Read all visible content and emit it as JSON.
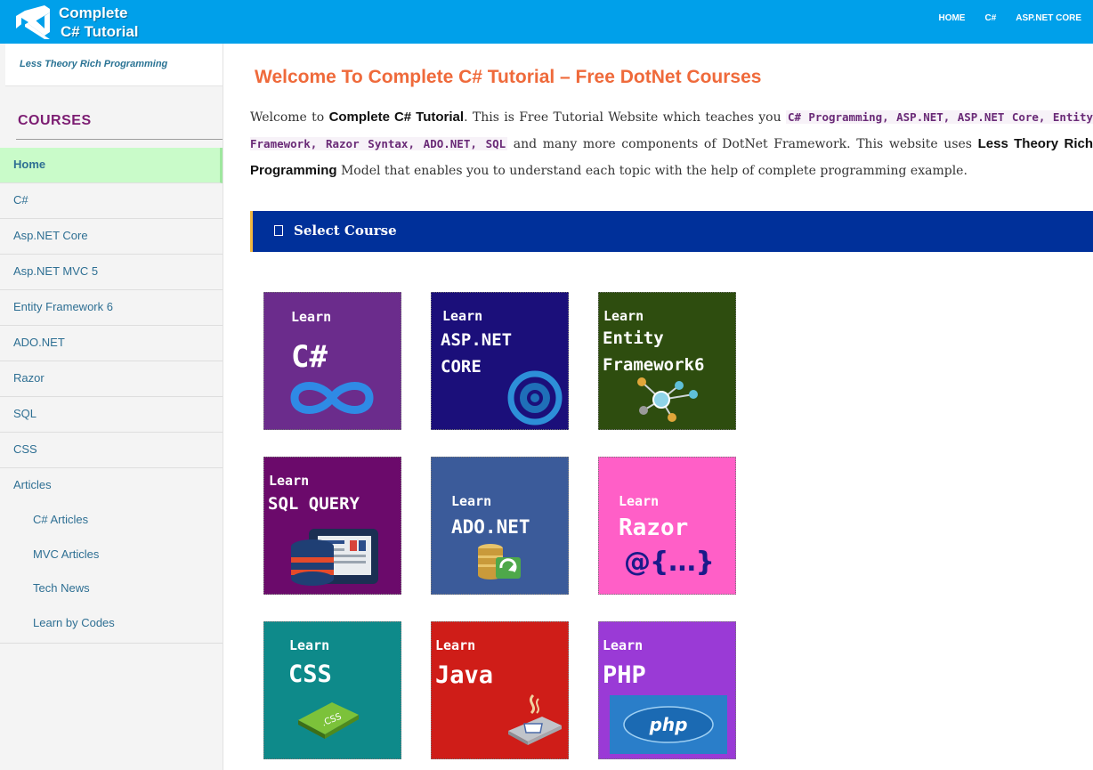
{
  "header": {
    "logo_line1": "Complete",
    "logo_line2": "C# Tutorial",
    "nav": [
      "HOME",
      "C#",
      "ASP.NET CORE"
    ],
    "bg_color": "#00a0ea"
  },
  "sidebar": {
    "tagline": "Less Theory Rich Programming",
    "courses_title": "COURSES",
    "items": [
      "Home",
      "C#",
      "Asp.NET Core",
      "Asp.NET MVC 5",
      "Entity Framework 6",
      "ADO.NET",
      "Razor",
      "SQL",
      "CSS",
      "Articles"
    ],
    "active_item": "Home",
    "articles_sub": [
      "C# Articles",
      "MVC Articles",
      "Tech News",
      "Learn by Codes"
    ]
  },
  "main": {
    "headline": "Welcome To Complete C# Tutorial – Free DotNet Courses",
    "intro": {
      "p1": "Welcome to ",
      "b1": "Complete C# Tutorial",
      "p2": ". This is Free Tutorial Website which teaches you ",
      "code1": "C# Programming, ASP.NET, ASP.NET Core, Entity Framework, Razor Syntax, ADO.NET, SQL",
      "p3": " and many more components of DotNet Framework. This website uses ",
      "b2": "Less Theory Rich Programming",
      "p4": " Model that enables you to understand each topic with the help of complete programming example."
    },
    "select_course_label": "Select Course",
    "tiles": [
      {
        "learn": "Learn",
        "name": "C#",
        "bg": "#6b2c8c",
        "icon": "infinity-icon"
      },
      {
        "learn": "Learn",
        "name": "ASP.NET\nCORE",
        "bg": "#1b0f7a",
        "icon": "gear-ring-icon"
      },
      {
        "learn": "Learn",
        "name": "Entity\nFramework6",
        "bg": "#2e4d0f",
        "icon": "network-nodes-icon"
      },
      {
        "learn": "Learn",
        "name": "SQL QUERY",
        "bg": "#6b0a6b",
        "icon": "database-icon"
      },
      {
        "learn": "Learn",
        "name": "ADO.NET",
        "bg": "#3b5b9a",
        "icon": "db-refresh-icon"
      },
      {
        "learn": "Learn",
        "name": "Razor",
        "bg": "#ff5fc7",
        "icon": "razor-syntax-icon"
      },
      {
        "learn": "Learn",
        "name": "CSS",
        "bg": "#0e8a8a",
        "icon": "css-chip-icon"
      },
      {
        "learn": "Learn",
        "name": "Java",
        "bg": "#cf1d18",
        "icon": "java-cup-icon"
      },
      {
        "learn": "Learn",
        "name": "PHP",
        "bg": "#9a3ad6",
        "icon": "php-logo-icon"
      }
    ],
    "razor_symbol": "@{...}",
    "css_chip_text": ".CSS",
    "php_logo_text": "php"
  }
}
